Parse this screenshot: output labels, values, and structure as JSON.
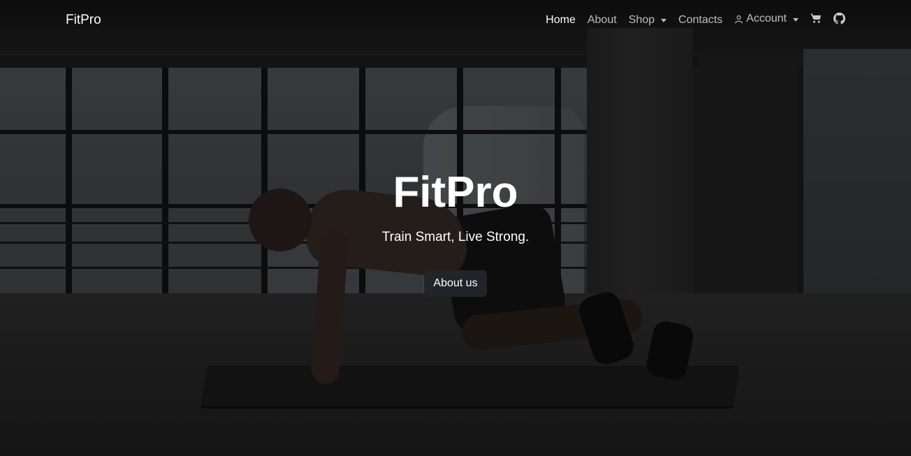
{
  "brand": "FitPro",
  "nav": {
    "home": "Home",
    "about": "About",
    "shop": "Shop",
    "contacts": "Contacts",
    "account": "Account"
  },
  "icons": {
    "account": "user-icon",
    "cart": "cart-icon",
    "github": "github-icon"
  },
  "hero": {
    "title": "FitPro",
    "tagline": "Train Smart, Live Strong.",
    "button_label": "About us"
  },
  "colors": {
    "nav_active": "#ffffff",
    "nav_inactive": "rgba(255,255,255,0.72)",
    "button_bg": "#212529",
    "overlay": "rgba(0,0,0,0.38)"
  }
}
